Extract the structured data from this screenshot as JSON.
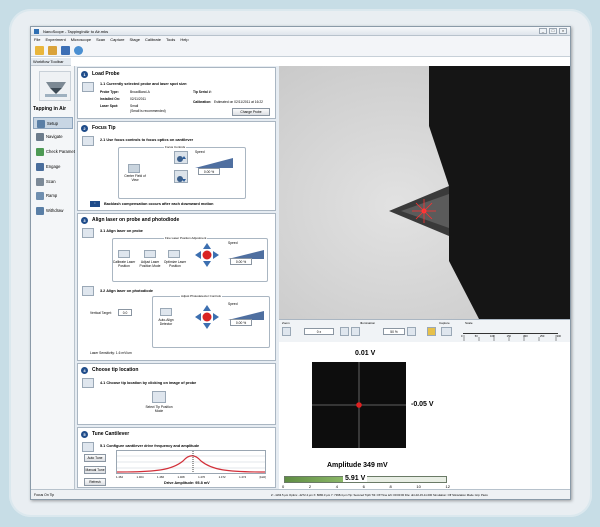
{
  "window": {
    "title": "NanoScope - TappingInAir to Air.mks",
    "controls": [
      "_",
      "□",
      "×"
    ]
  },
  "menu": [
    "File",
    "Experiment",
    "Microscope",
    "Scan",
    "Capture",
    "Stage",
    "Calibrate",
    "Tools",
    "Help"
  ],
  "workflow": {
    "toolbar_label": "Workflow Toolbar",
    "title": "Tapping in Air",
    "items": [
      {
        "label": "Setup",
        "active": true,
        "icon": "setup-icon"
      },
      {
        "label": "Navigate",
        "active": false,
        "icon": "navigate-icon"
      },
      {
        "label": "Check Parameters",
        "active": false,
        "icon": "check-parameters-icon"
      },
      {
        "label": "Engage",
        "active": false,
        "icon": "engage-icon"
      },
      {
        "label": "Scan",
        "active": false,
        "icon": "scan-icon"
      },
      {
        "label": "Ramp",
        "active": false,
        "icon": "ramp-icon"
      },
      {
        "label": "Withdraw",
        "active": false,
        "icon": "withdraw-icon"
      }
    ]
  },
  "steps": {
    "load": {
      "num": "1",
      "title": "Load Probe",
      "sub": "1.1 Currently selected probe and laser spot size:",
      "probe_type_label": "Probe Type:",
      "probe_type": "BroadBand-A",
      "tip_serial_label": "Tip Serial #:",
      "installed_label": "Installed On:",
      "installed": "02/11/2011",
      "calibration_label": "Calibration:",
      "calibration": "Estimated on 02/11/2011 at 16:22",
      "laser_label": "Laser Spot:",
      "laser": "Small",
      "laser_note": "(Small is recommended)",
      "change_btn": "Change Probe"
    },
    "focus": {
      "num": "2",
      "title": "Focus Tip",
      "sub": "2.1 Use focus controls to focus optics on cantilever",
      "group": "Focus Controls",
      "center_btn": "Center Field of View",
      "speed_label": "Speed",
      "speed_value": "0.00 %",
      "note": "Backlash compensation occurs after each downward motion"
    },
    "align": {
      "num": "3",
      "title": "Align laser on probe and photodiode",
      "sub1": "3.1 Align laser on probe",
      "laser_group": "Fine Laser Position Adjustment",
      "btn_cal": "Calibrate Laser Position",
      "btn_adj": "Adjust Laser Position Mode",
      "btn_opt": "Optimize Laser Position",
      "speed_label": "Speed",
      "speed1": "0.00 %",
      "sub2": "3.2 Align laser on photodiode",
      "pd_group": "Adjust Photodetector Controls",
      "vt_label": "Vertical Target:",
      "vt_value": "0.0",
      "auto_btn": "Auto-Align Detector",
      "speed2": "0.00 %",
      "laser_sens": "Laser Sensitivity:   1.6 mV/um"
    },
    "tip": {
      "num": "4",
      "title": "Choose tip location",
      "sub": "4.1 Choose tip location by clicking on image of probe",
      "btn": "Select Tip Position Mode"
    },
    "tune": {
      "num": "5",
      "title": "Tune Cantilever",
      "sub": "5.1 Configure cantilever drive frequency and amplitude",
      "auto_btn": "Auto Tune",
      "manual_btn": "Manual Tune",
      "refresh_btn": "Refresh",
      "ticks": [
        "1.462",
        "1.464",
        "1.466",
        "1.468",
        "1.470",
        "1.472",
        "1.474"
      ],
      "unit": "[kHz]",
      "drive": "Drive Amplitude: 95.8 mV"
    }
  },
  "camera": {
    "zoom_label": "Zoom",
    "zoom_value": "0 x",
    "illum_label": "Illumination",
    "illum_value": "50 %",
    "capture_label": "Capture",
    "scale_label": "Scale",
    "scale_ticks": [
      "0",
      "50",
      "100",
      "150",
      "200",
      "250",
      "300"
    ]
  },
  "detector": {
    "top": "0.01 V",
    "right": "-0.05 V",
    "amplitude": "Amplitude 349 mV",
    "sum_value": "5.91 V",
    "sum_level": 0.4,
    "scale": [
      "0",
      "2",
      "4",
      "6",
      "8",
      "10",
      "12"
    ]
  },
  "status": {
    "left": "Focus On Tip",
    "right": "Z: -1163.5 µm   Optics: -4272.4 µm X: 8080.3 µm   Y: 7398.4 µm   Tip: Secured   Tipth   Tilt: Off   Time left: 00:00:00   File: dnt-02-15-11.000   Simulation: Off   Stimulation Mode: Hip: Piezo"
  },
  "colors": {
    "accent": "#1f4c8a",
    "laser": "#e02020",
    "sum_bar": "#6a9a48",
    "tune_curve": "#d2303a"
  }
}
